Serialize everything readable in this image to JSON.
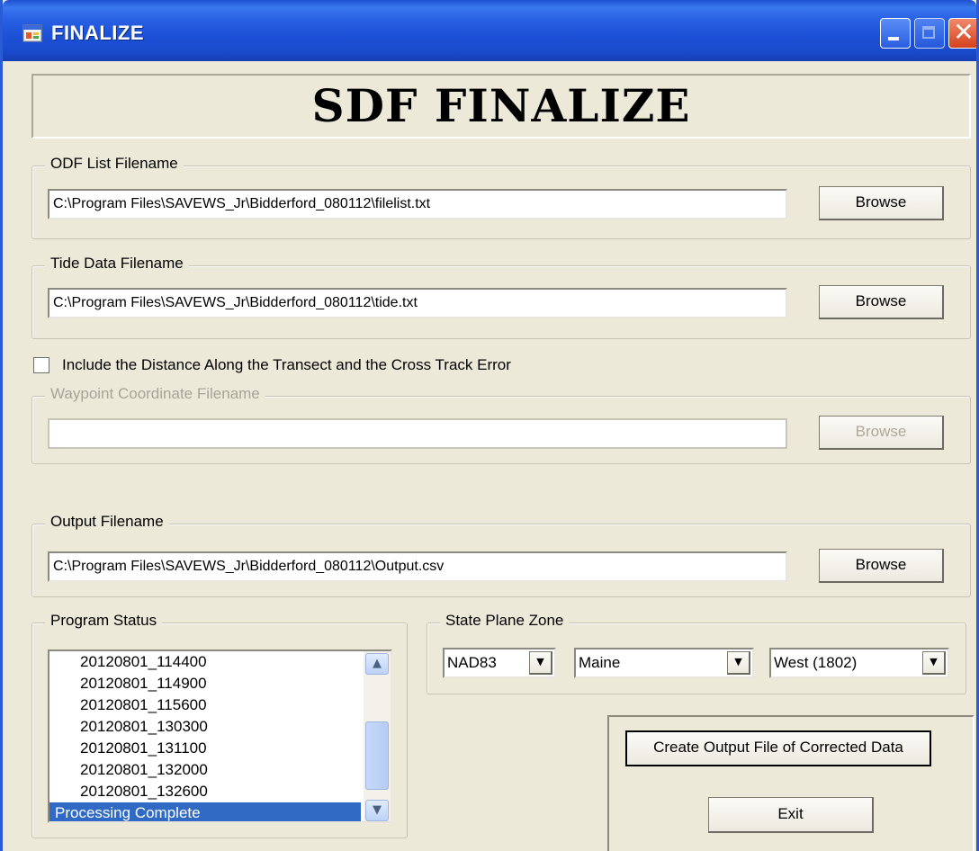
{
  "window": {
    "title": "FINALIZE",
    "icon": "app-form-icon",
    "controls": {
      "minimize_icon": "minimize-icon",
      "maximize_icon": "maximize-icon",
      "close_label": "✕"
    }
  },
  "banner": {
    "title": "SDF FINALIZE"
  },
  "odf_list": {
    "label": "ODF List Filename",
    "value": "C:\\Program Files\\SAVEWS_Jr\\Bidderford_080112\\filelist.txt",
    "browse_label": "Browse"
  },
  "tide_data": {
    "label": "Tide Data Filename",
    "value": "C:\\Program Files\\SAVEWS_Jr\\Bidderford_080112\\tide.txt",
    "browse_label": "Browse"
  },
  "include_option": {
    "label": "Include the Distance Along the Transect and the Cross Track Error",
    "checked": false
  },
  "waypoint": {
    "label": "Waypoint Coordinate Filename",
    "value": "",
    "browse_label": "Browse",
    "enabled": false
  },
  "output": {
    "label": "Output Filename",
    "value": "C:\\Program Files\\SAVEWS_Jr\\Bidderford_080112\\Output.csv",
    "browse_label": "Browse"
  },
  "program_status": {
    "label": "Program Status",
    "items": [
      "20120801_114400",
      "20120801_114900",
      "20120801_115600",
      "20120801_130300",
      "20120801_131100",
      "20120801_132000",
      "20120801_132600"
    ],
    "selected_item": "Processing Complete",
    "scroll_up": "▲",
    "scroll_down": "▼"
  },
  "state_plane": {
    "label": "State Plane Zone",
    "datum": "NAD83",
    "state": "Maine",
    "zone": "West (1802)",
    "dropdown_glyph": "▼"
  },
  "actions": {
    "create_label": "Create Output File of Corrected Data",
    "exit_label": "Exit"
  },
  "colors": {
    "titlebar": "#2a62e4",
    "window_bg": "#ece9d8",
    "selection": "#316ac5",
    "disabled_text": "#aca899"
  }
}
